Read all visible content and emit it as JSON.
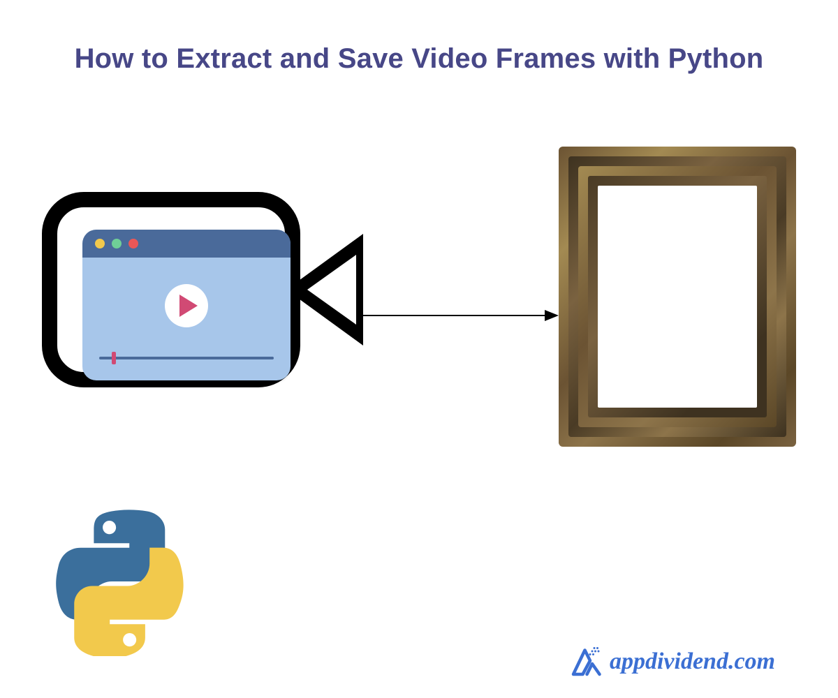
{
  "title": "How to Extract and Save Video Frames with Python",
  "brand": {
    "text": "appdividend.com"
  },
  "icons": {
    "camera": "video-camera-icon",
    "player": "browser-video-player-icon",
    "play": "play-icon",
    "arrow": "arrow-right-icon",
    "frame": "picture-frame-icon",
    "python": "python-logo-icon",
    "brand_mark": "appdividend-logo-icon"
  },
  "colors": {
    "title": "#474787",
    "brand_text": "#3b6fd3",
    "player_bg": "#a7c6ea",
    "player_header": "#4a6a9a",
    "accent": "#d14a74",
    "python_blue": "#3b6f9c",
    "python_yellow": "#f2c94c"
  }
}
